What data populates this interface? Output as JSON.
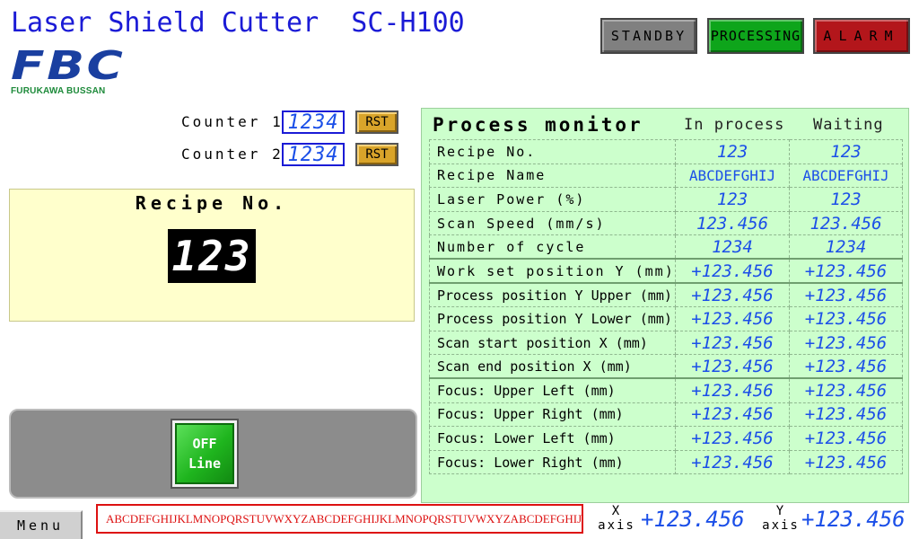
{
  "header": {
    "title": "Laser Shield Cutter  SC-H100",
    "logo": {
      "letters": "FBC",
      "subtitle": "FURUKAWA BUSSAN"
    }
  },
  "status": {
    "standby": "STANDBY",
    "processing": "PROCESSING",
    "alarm": "ALARM",
    "colors": {
      "standby": "#808080",
      "processing": "#0ea51b",
      "alarm": "#b3161b"
    }
  },
  "counters": [
    {
      "label": "Counter 1",
      "value": "1234",
      "reset_label": "RST"
    },
    {
      "label": "Counter 2",
      "value": "1234",
      "reset_label": "RST"
    }
  ],
  "recipe": {
    "title": "Recipe No.",
    "value": "123"
  },
  "offline_button": {
    "line1": "OFF",
    "line2": "Line"
  },
  "monitor": {
    "title": "Process monitor",
    "col_in_process": "In process",
    "col_waiting": "Waiting",
    "rows": [
      {
        "label": "Recipe No.",
        "in_process": "123",
        "waiting": "123"
      },
      {
        "label": "Recipe Name",
        "in_process": "ABCDEFGHIJ",
        "waiting": "ABCDEFGHIJ"
      },
      {
        "label": "Laser Power (%)",
        "in_process": "123",
        "waiting": "123"
      },
      {
        "label": "Scan Speed (mm/s)",
        "in_process": "123.456",
        "waiting": "123.456"
      },
      {
        "label": "Number of cycle",
        "in_process": "1234",
        "waiting": "1234"
      },
      {
        "label": "Work set position Y (mm)",
        "in_process": "+123.456",
        "waiting": "+123.456"
      },
      {
        "label": "Process position Y Upper (mm)",
        "in_process": "+123.456",
        "waiting": "+123.456"
      },
      {
        "label": "Process position Y Lower (mm)",
        "in_process": "+123.456",
        "waiting": "+123.456"
      },
      {
        "label": "Scan start position X (mm)",
        "in_process": "+123.456",
        "waiting": "+123.456"
      },
      {
        "label": "Scan end position X (mm)",
        "in_process": "+123.456",
        "waiting": "+123.456"
      },
      {
        "label": "Focus: Upper Left (mm)",
        "in_process": "+123.456",
        "waiting": "+123.456"
      },
      {
        "label": "Focus: Upper Right (mm)",
        "in_process": "+123.456",
        "waiting": "+123.456"
      },
      {
        "label": "Focus: Lower Left (mm)",
        "in_process": "+123.456",
        "waiting": "+123.456"
      },
      {
        "label": "Focus: Lower Right (mm)",
        "in_process": "+123.456",
        "waiting": "+123.456"
      }
    ]
  },
  "footer": {
    "menu_label": "Menu",
    "message": "ABCDEFGHIJKLMNOPQRSTUVWXYZABCDEFGHIJKLMNOPQRSTUVWXYZABCDEFGHIJKLM",
    "x_axis": {
      "letter": "X",
      "word": "axis",
      "value": "+123.456"
    },
    "y_axis": {
      "letter": "Y",
      "word": "axis",
      "value": "+123.456"
    }
  }
}
